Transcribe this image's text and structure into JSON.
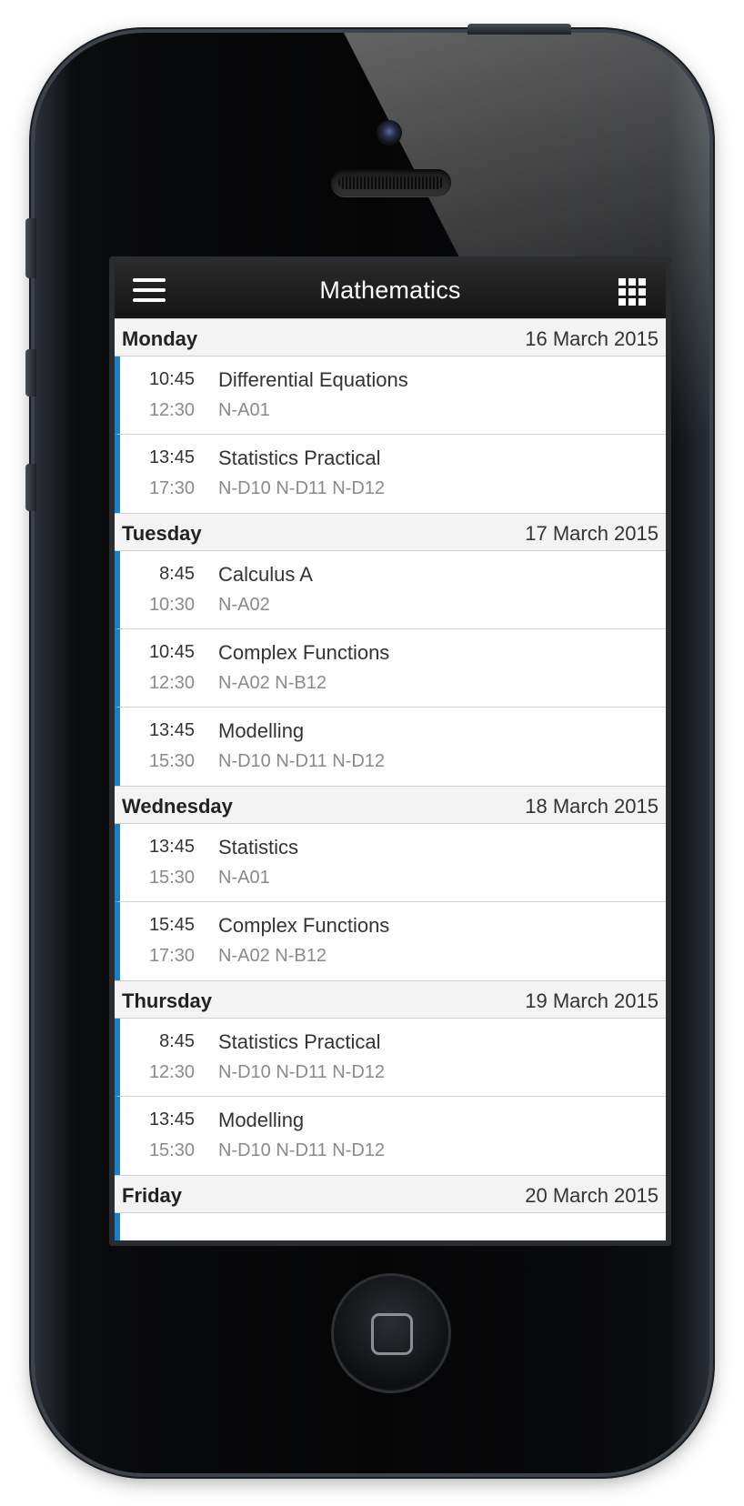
{
  "header": {
    "title": "Mathematics",
    "left_icon": "menu-icon",
    "right_icon": "grid-icon"
  },
  "accent_color": "#1a7fc4",
  "days": [
    {
      "name": "Monday",
      "date": "16 March 2015",
      "events": [
        {
          "start": "10:45",
          "end": "12:30",
          "title": "Differential Equations",
          "rooms": "N-A01"
        },
        {
          "start": "13:45",
          "end": "17:30",
          "title": "Statistics Practical",
          "rooms": "N-D10 N-D11 N-D12"
        }
      ]
    },
    {
      "name": "Tuesday",
      "date": "17 March 2015",
      "events": [
        {
          "start": "8:45",
          "end": "10:30",
          "title": "Calculus A",
          "rooms": "N-A02"
        },
        {
          "start": "10:45",
          "end": "12:30",
          "title": "Complex Functions",
          "rooms": "N-A02 N-B12"
        },
        {
          "start": "13:45",
          "end": "15:30",
          "title": "Modelling",
          "rooms": "N-D10 N-D11 N-D12"
        }
      ]
    },
    {
      "name": "Wednesday",
      "date": "18 March 2015",
      "events": [
        {
          "start": "13:45",
          "end": "15:30",
          "title": "Statistics",
          "rooms": "N-A01"
        },
        {
          "start": "15:45",
          "end": "17:30",
          "title": "Complex Functions",
          "rooms": "N-A02 N-B12"
        }
      ]
    },
    {
      "name": "Thursday",
      "date": "19 March 2015",
      "events": [
        {
          "start": "8:45",
          "end": "12:30",
          "title": "Statistics Practical",
          "rooms": "N-D10 N-D11 N-D12"
        },
        {
          "start": "13:45",
          "end": "15:30",
          "title": "Modelling",
          "rooms": "N-D10 N-D11 N-D12"
        }
      ]
    },
    {
      "name": "Friday",
      "date": "20 March 2015",
      "events": []
    }
  ]
}
